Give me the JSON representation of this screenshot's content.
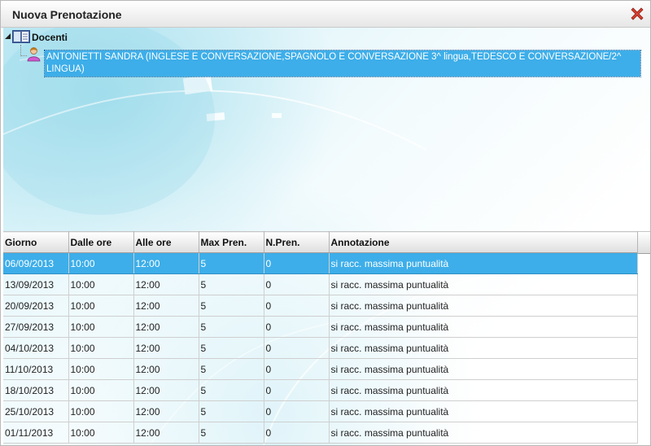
{
  "window": {
    "title": "Nuova Prenotazione",
    "close_icon": "close-x-icon",
    "close_color": "#d94030"
  },
  "tree": {
    "root": {
      "icon": "book-icon",
      "label": "Docenti"
    },
    "children": [
      {
        "icon": "person-icon",
        "label": "ANTONIETTI SANDRA (INGLESE E CONVERSAZIONE,SPAGNOLO E CONVERSAZIONE 3^ lingua,TEDESCO E CONVERSAZIONE/2^ LINGUA)",
        "selected": true
      }
    ]
  },
  "grid": {
    "columns": [
      "Giorno",
      "Dalle ore",
      "Alle ore",
      "Max Pren.",
      "N.Pren.",
      "Annotazione"
    ],
    "rows": [
      [
        "06/09/2013",
        "10:00",
        "12:00",
        "5",
        "0",
        "si racc. massima puntualità"
      ],
      [
        "13/09/2013",
        "10:00",
        "12:00",
        "5",
        "0",
        "si racc. massima puntualità"
      ],
      [
        "20/09/2013",
        "10:00",
        "12:00",
        "5",
        "0",
        "si racc. massima puntualità"
      ],
      [
        "27/09/2013",
        "10:00",
        "12:00",
        "5",
        "0",
        "si racc. massima puntualità"
      ],
      [
        "04/10/2013",
        "10:00",
        "12:00",
        "5",
        "0",
        "si racc. massima puntualità"
      ],
      [
        "11/10/2013",
        "10:00",
        "12:00",
        "5",
        "0",
        "si racc. massima puntualità"
      ],
      [
        "18/10/2013",
        "10:00",
        "12:00",
        "5",
        "0",
        "si racc. massima puntualità"
      ],
      [
        "25/10/2013",
        "10:00",
        "12:00",
        "5",
        "0",
        "si racc. massima puntualità"
      ],
      [
        "01/11/2013",
        "10:00",
        "12:00",
        "5",
        "0",
        "si racc. massima puntualità"
      ]
    ],
    "selected_row": 0
  },
  "colors": {
    "selection": "#3daee9",
    "background_accent": "#cfeff7"
  }
}
